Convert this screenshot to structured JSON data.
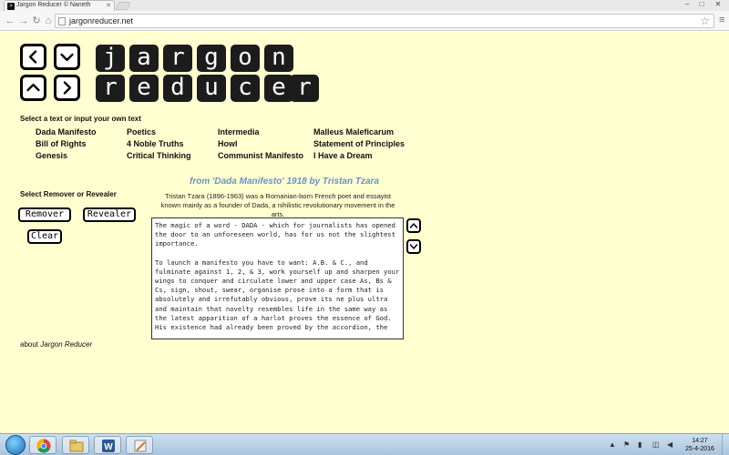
{
  "browser": {
    "tab_title": "Jargon Reducer © Naneth",
    "url": "jargonreducer.net"
  },
  "logo": {
    "word1": [
      "j",
      "a",
      "r",
      "g",
      "o",
      "n"
    ],
    "word2": [
      "r",
      "e",
      "d",
      "u",
      "c",
      "e",
      "r"
    ]
  },
  "select_text_label": "Select a text or input your own text",
  "texts": {
    "col1": [
      "Dada Manifesto",
      "Bill of Rights",
      "Genesis"
    ],
    "col2": [
      "Poetics",
      "4 Noble Truths",
      "Critical Thinking"
    ],
    "col3": [
      "Intermedia",
      "Howl",
      "Communist Manifesto"
    ],
    "col4": [
      "Malleus Maleficarum",
      "Statement of Principles",
      "I Have a Dream"
    ]
  },
  "remover_label": "Select Remover or Revealer",
  "buttons": {
    "remover": "Remover",
    "revealer": "Revealer",
    "clear": "Clear"
  },
  "source": {
    "prefix": "from '",
    "title": "Dada Manifesto",
    "suffix": "' 1918 by Tristan Tzara"
  },
  "bio": "Tristan Tzara (1896-1963) was a Romanian-born French poet and essayist known mainly as a founder of Dada, a nihilistic revolutionary movement in the arts.",
  "text_content": {
    "p1": "The magic of a word - DADA - which for journalists has opened the door to an unforeseen world, has for us not the slightest importance.",
    "p2": "To launch a manifesto you have to want: A.B. & C., and fulminate against 1, 2, & 3, work yourself up and sharpen your wings to conquer and circulate lower and upper case As, Bs & Cs, sign, shout, swear, organise prose into a form that is absolutely and irrefutably obvious, prove its ne plus ultra and maintain that novelty resembles life in the same way as the latest apparition of a harlot proves the essence of God. His existence had already been proved by the accordion, the"
  },
  "about": {
    "prefix": "about ",
    "name": "Jargon Reducer"
  },
  "taskbar": {
    "time": "14:27",
    "date": "25-4-2016"
  },
  "colors": {
    "page_background": "#ffffd0",
    "source_blue": "#6b91c6",
    "tile_black": "#1c1c1c"
  }
}
